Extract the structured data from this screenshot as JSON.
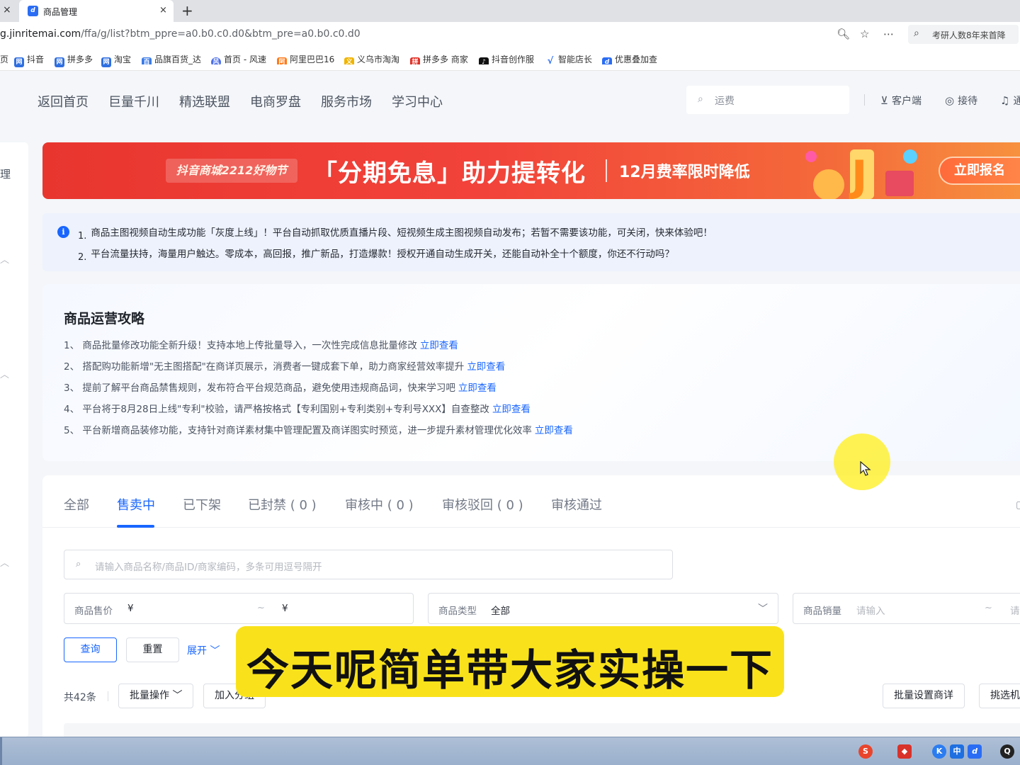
{
  "browser": {
    "prev_tab_close": "×",
    "tab_title": "商品管理",
    "tab_logo": "d",
    "tab_close": "×",
    "new_tab": "+",
    "url_host": "g.jinritemai.com",
    "url_path": "/ffa/g/list?btm_ppre=a0.b0.c0.d0&btm_pre=a0.b0.c0.d0",
    "search_text": "考研人数8年来首降",
    "bookmarks": [
      "抖音",
      "拼多多",
      "淘宝",
      "品旗百货_达",
      "首页 - 风速",
      "阿里巴巴16",
      "义乌市淘淘",
      "拼多多 商家",
      "抖音创作服",
      "智能店长",
      "优惠叠加查"
    ]
  },
  "topnav": {
    "items": [
      "返回首页",
      "巨量千川",
      "精选联盟",
      "电商罗盘",
      "服务市场",
      "学习中心"
    ],
    "search_placeholder": "运费",
    "tools": [
      "客户端",
      "接待",
      "通"
    ]
  },
  "sidebar": {
    "label": "理"
  },
  "banner": {
    "tag": "抖音商城2212好物节",
    "headline": "「分期免息」助力提转化",
    "sub": "12月费率限时降低",
    "button": "立即报名"
  },
  "notice": {
    "icon": "i",
    "lines": [
      {
        "num": "1.",
        "text": "商品主图视频自动生成功能「灰度上线」！平台自动抓取优质直播片段、短视频生成主图视频自动发布；若暂不需要该功能，可关闭，快来体验吧！"
      },
      {
        "num": "2.",
        "text": "平台流量扶持，海量用户触达。零成本，高回报，推广新品，打造爆款！授权开通自动生成开关，还能自动补全十个额度，你还不行动吗？"
      }
    ]
  },
  "guide": {
    "title": "商品运营攻略",
    "items": [
      {
        "text": "1、 商品批量修改功能全新升级！支持本地上传批量导入，一次性完成信息批量修改",
        "link": "立即查看"
      },
      {
        "text": "2、 搭配购功能新增\"无主图搭配\"在商详页展示，消费者一键成套下单，助力商家经营效率提升",
        "link": "立即查看"
      },
      {
        "text": "3、 提前了解平台商品禁售规则，发布符合平台规范商品，避免使用违规商品词，快来学习吧",
        "link": "立即查看"
      },
      {
        "text": "4、 平台将于8月28日上线\"专利\"校验，请严格按格式【专利国别+专利类别+专利号XXX】自查整改",
        "link": "立即查看"
      },
      {
        "text": "5、 平台新增商品装修功能，支持针对商详素材集中管理配置及商详图实时预览，进一步提升素材管理优化效率",
        "link": "立即查看"
      }
    ]
  },
  "tabs": [
    "全部",
    "售卖中",
    "已下架",
    "已封禁 ( 0 )",
    "审核中 ( 0 )",
    "审核驳回 ( 0 )",
    "审核通过"
  ],
  "active_tab": "售卖中",
  "search": {
    "placeholder": "请输入商品名称/商品ID/商家编码，多条可用逗号隔开"
  },
  "filters": {
    "price_label": "商品售价",
    "currency": "¥",
    "tilde": "~",
    "type_label": "商品类型",
    "type_value": "全部",
    "sales_label": "商品销量",
    "sales_placeholder": "请输入",
    "sales_placeholder_cut": "请"
  },
  "buttons": {
    "query": "查询",
    "reset": "重置",
    "expand": "展开",
    "batch_ops": "批量操作",
    "add": "加入分组",
    "batch_detail": "批量设置商详",
    "pick": "挑选机"
  },
  "list": {
    "total": "共42条"
  },
  "subtitle": "今天呢简单带大家实操一下",
  "colors": {
    "primary": "#1966ff",
    "banner": "#e8362f",
    "subtitle_bg": "#f9e21b"
  }
}
